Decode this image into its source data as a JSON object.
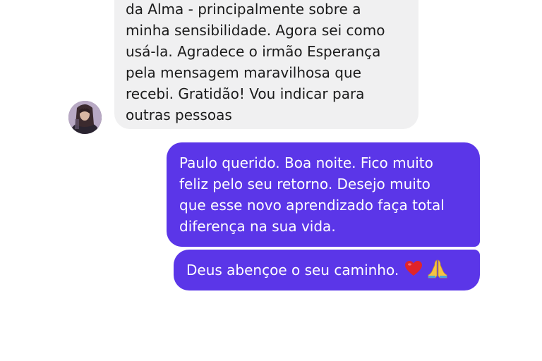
{
  "chat": {
    "incoming": {
      "lines": [
        "da Alma - principalmente sobre a",
        "minha sensibilidade. Agora sei como",
        "usá-la. Agradece o irmão Esperança",
        "pela mensagem maravilhosa que",
        "recebi. Gratidão! Vou indicar para",
        "outras pessoas"
      ]
    },
    "outgoing": [
      {
        "lines": [
          "Paulo querido. Boa noite. Fico muito",
          "feliz pelo seu retorno. Desejo muito",
          "que esse novo aprendizado faça total",
          "diferença na sua vida."
        ]
      },
      {
        "text": "Deus abençoe o seu caminho.",
        "emojis": [
          "heart-icon",
          "praying-hands-icon"
        ]
      }
    ]
  },
  "colors": {
    "incoming_bubble": "#f0f0f1",
    "outgoing_bubble": "#5b36e8",
    "incoming_text": "#1b1b1b",
    "outgoing_text": "#ffffff"
  }
}
